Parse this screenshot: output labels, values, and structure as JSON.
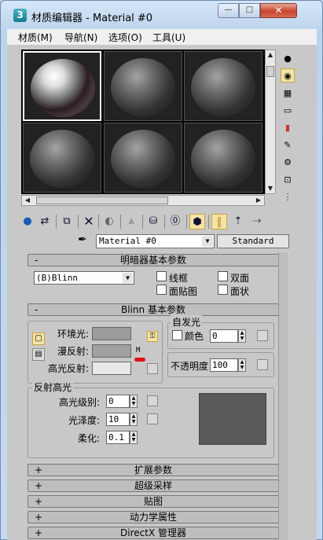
{
  "window": {
    "icon": "3",
    "title": "材质编辑器 - Material #0",
    "minimize": "—",
    "maximize": "□",
    "close": "✕"
  },
  "menu": [
    "材质(M)",
    "导航(N)",
    "选项(O)",
    "工具(U)"
  ],
  "toolbar_icons": [
    "get-material",
    "put-to-scene",
    "assign-to-selection",
    "reset",
    "make-copy",
    "make-unique",
    "put-to-library",
    "material-id-channel",
    "show-in-viewport",
    "show-end-result",
    "go-to-parent",
    "go-forward-to-sibling"
  ],
  "picker": {
    "material_name": "Material #0",
    "material_type": "Standard"
  },
  "shader_rollout": {
    "header": "明暗器基本参数",
    "toggle": "-",
    "shader": "(B)Blinn",
    "wire": "线框",
    "two_sided": "双面",
    "face_map": "面贴图",
    "faceted": "面状"
  },
  "blinn_rollout": {
    "header": "Blinn 基本参数",
    "toggle": "-",
    "ambient": "环境光:",
    "diffuse": "漫反射:",
    "specular": "高光反射:",
    "map_lock": "M",
    "self_illum_title": "自发光",
    "color_label": "颜色",
    "color_value": "0",
    "opacity_label": "不透明度",
    "opacity_value": "100",
    "colors": {
      "ambient": "#9b9b9b",
      "diffuse": "#a0a0a0",
      "specular": "#e8e8e8",
      "preview": "#5a5a5a"
    }
  },
  "specular_highlights": {
    "title": "反射高光",
    "level_label": "高光级别:",
    "level_value": "0",
    "gloss_label": "光泽度:",
    "gloss_value": "10",
    "soften_label": "柔化:",
    "soften_value": "0.1"
  },
  "collapsed_rollouts": [
    {
      "toggle": "+",
      "label": "扩展参数"
    },
    {
      "toggle": "+",
      "label": "超级采样"
    },
    {
      "toggle": "+",
      "label": "贴图"
    },
    {
      "toggle": "+",
      "label": "动力学属性"
    },
    {
      "toggle": "+",
      "label": "DirectX 管理器"
    }
  ]
}
